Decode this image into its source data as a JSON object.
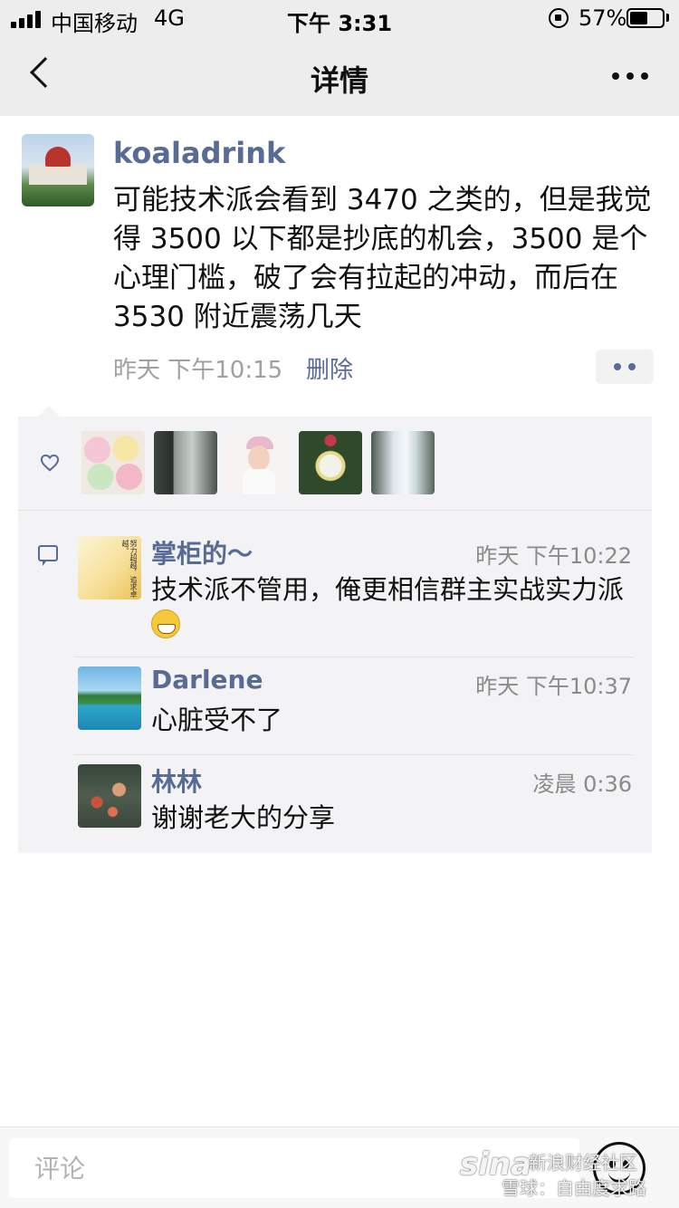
{
  "status_bar": {
    "carrier": "中国移动",
    "network": "4G",
    "time": "下午 3:31",
    "battery_percent": "57%",
    "battery_level": 0.57
  },
  "nav": {
    "title": "详情"
  },
  "post": {
    "username": "koaladrink",
    "text": "可能技术派会看到 3470 之类的，但是我觉得 3500 以下都是抄底的机会，3500 是个心理门槛，破了会有拉起的冲动，而后在 3530 附近震荡几天",
    "time": "昨天 下午10:15",
    "delete_label": "删除"
  },
  "likes": {
    "avatars": [
      "marshmallow-avatar",
      "doorway-avatar",
      "woman-cap-avatar",
      "water-lily-avatar",
      "waterfall-avatar"
    ]
  },
  "comments": [
    {
      "name": "掌柜的～",
      "time": "昨天 下午10:22",
      "text": "技术派不管用，俺更相信群主实战实力派",
      "avatar_text": "努力超越，追求卓越。"
    },
    {
      "name": "Darlene",
      "time": "昨天 下午10:37",
      "text": "心脏受不了"
    },
    {
      "name": "林林",
      "time": "凌晨 0:36",
      "text": "谢谢老大的分享"
    }
  ],
  "input": {
    "placeholder": "评论"
  },
  "watermark": {
    "logo": "sina",
    "line1": "新浪财经社区",
    "line2": "雪球：自由度求路"
  },
  "colors": {
    "link": "#576b95",
    "panel_bg": "#f3f3f5",
    "bar_bg": "#ededed"
  }
}
